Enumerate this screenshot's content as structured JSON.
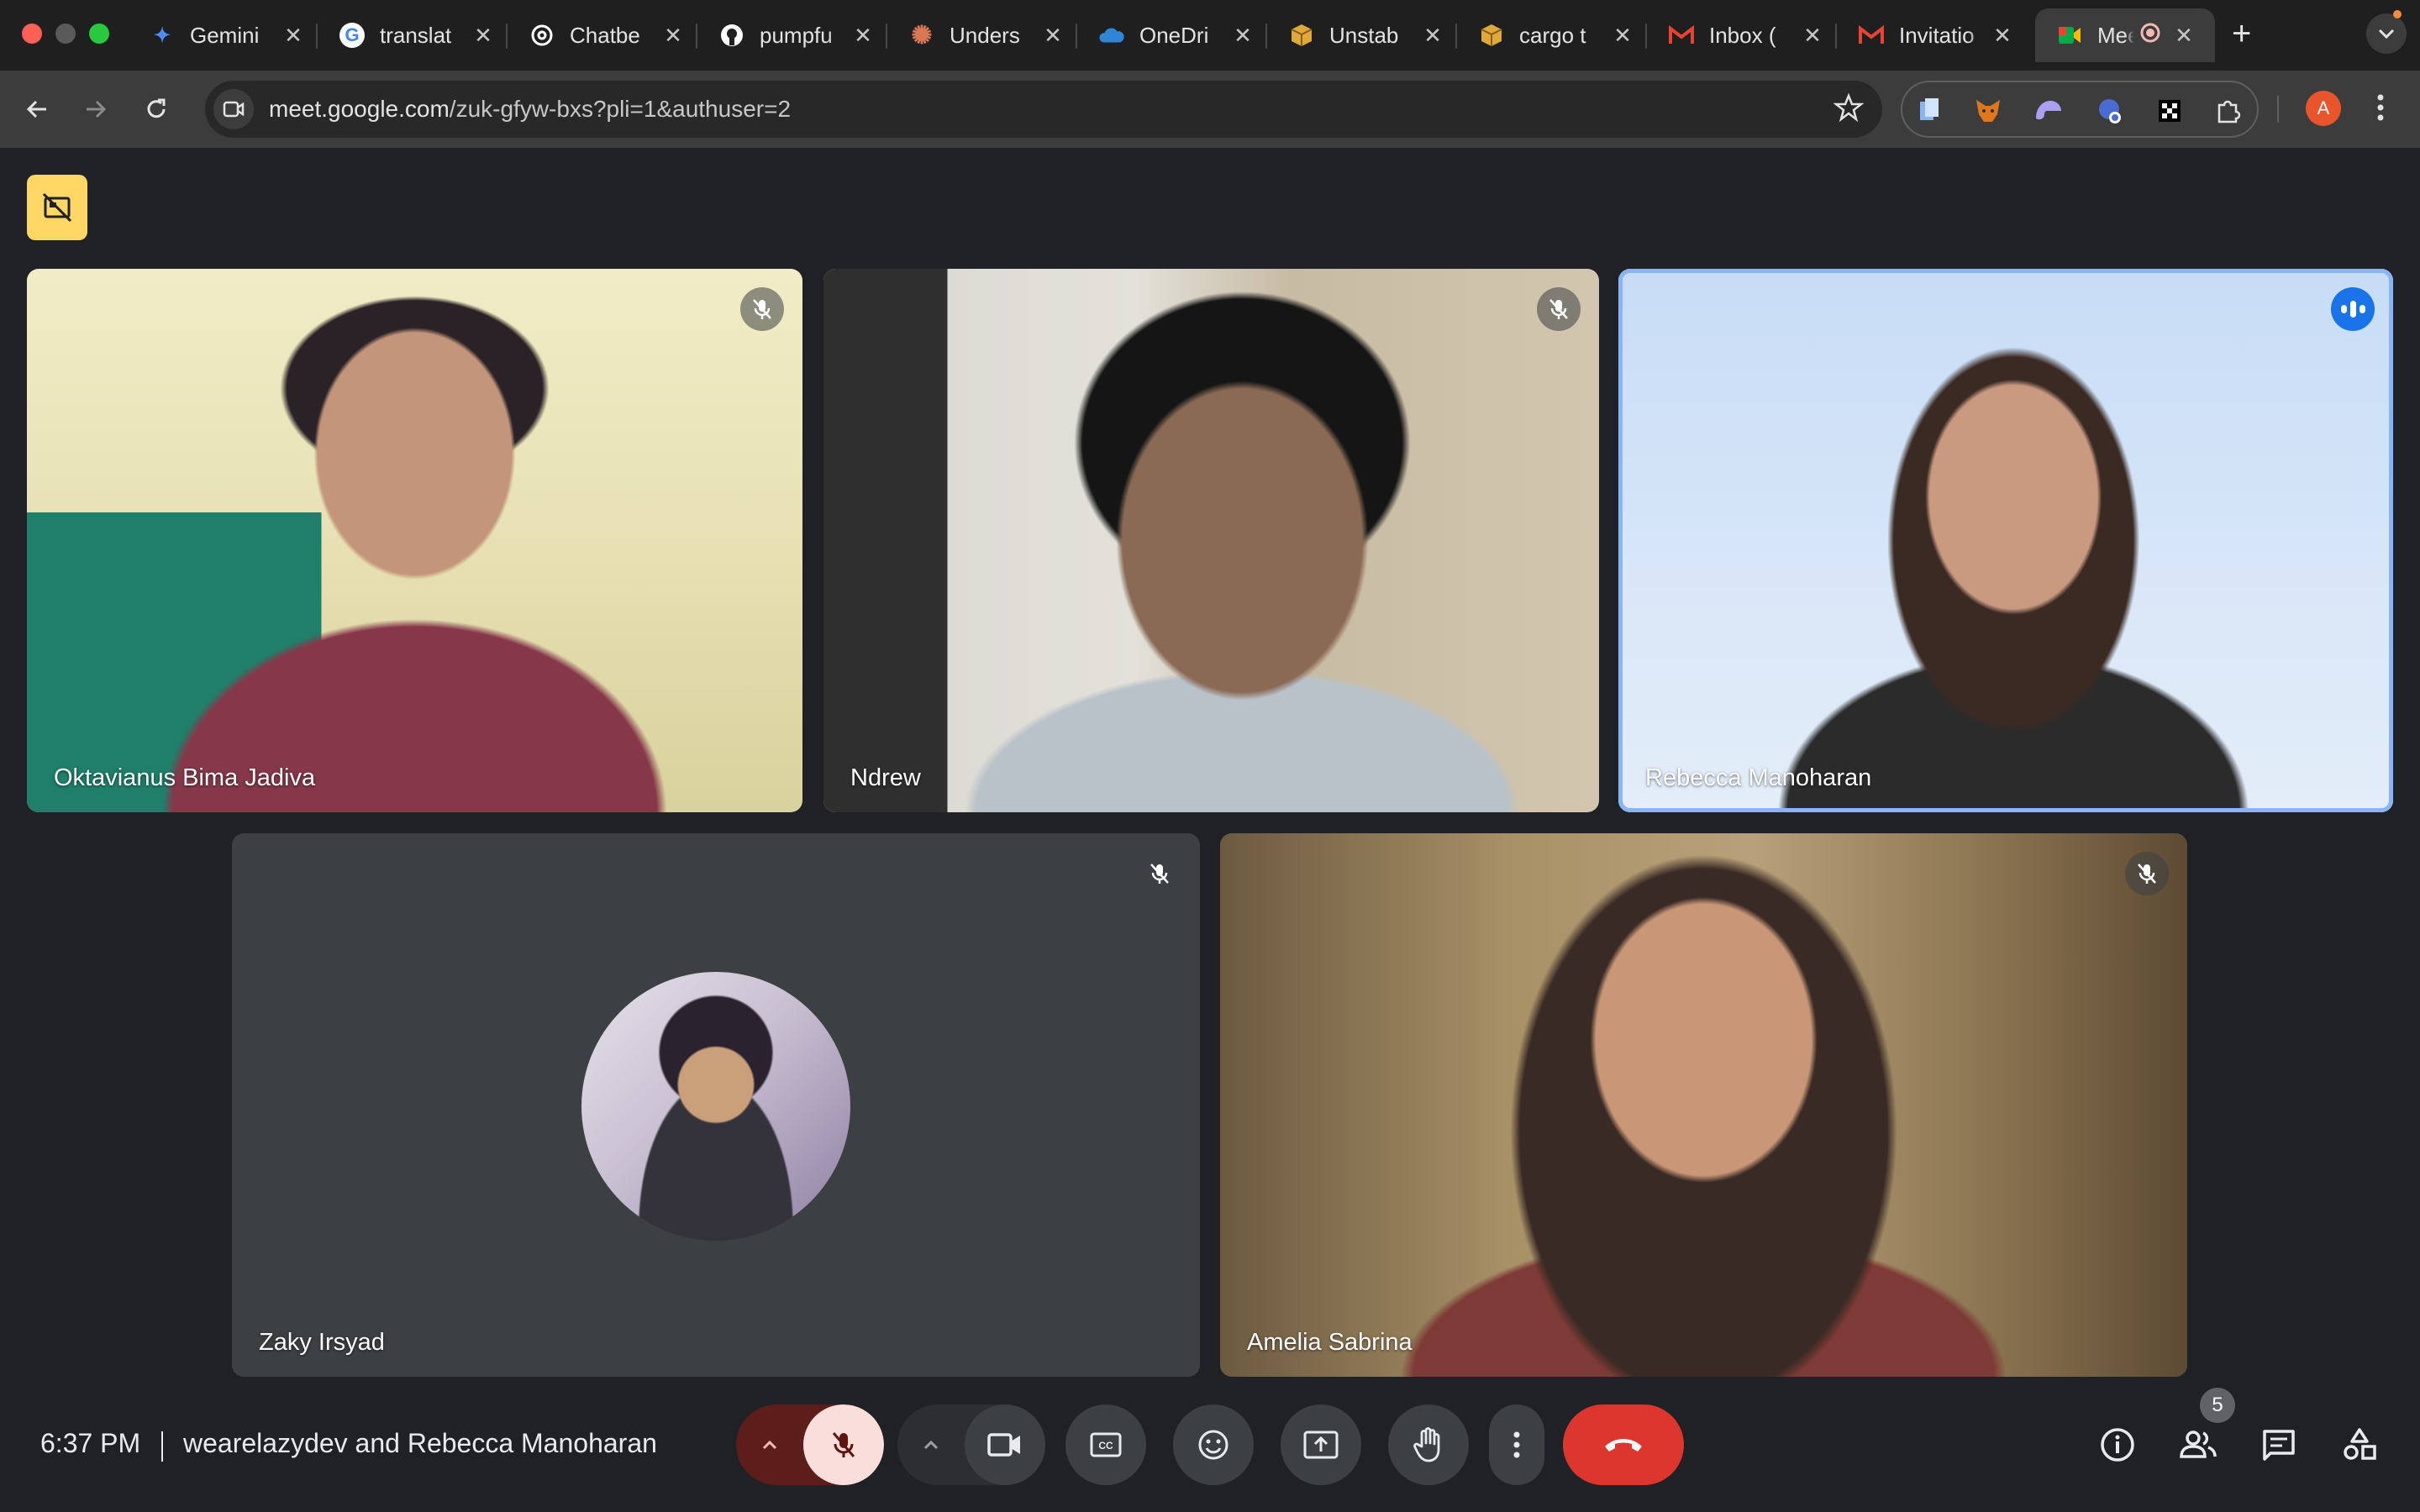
{
  "browser": {
    "tabs": [
      {
        "title": "Gemini",
        "icon": "gemini-icon",
        "color": "#4f8ef7"
      },
      {
        "title": "translat",
        "icon": "google-icon",
        "color": "#ffffff"
      },
      {
        "title": "Chatbe",
        "icon": "openai-icon",
        "color": "#ffffff"
      },
      {
        "title": "pumpfu",
        "icon": "github-icon",
        "color": "#ffffff"
      },
      {
        "title": "Unders",
        "icon": "claude-icon",
        "color": "#d97757"
      },
      {
        "title": "OneDri",
        "icon": "onedrive-icon",
        "color": "#2f86d8"
      },
      {
        "title": "Unstab",
        "icon": "package-icon",
        "color": "#e0a93b"
      },
      {
        "title": "cargo t",
        "icon": "package-icon",
        "color": "#e0a93b"
      },
      {
        "title": "Inbox (",
        "icon": "gmail-icon",
        "color": "#ea4335"
      },
      {
        "title": "Invitatio",
        "icon": "gmail-icon",
        "color": "#ea4335"
      },
      {
        "title": "Mee",
        "icon": "meet-icon",
        "color": "#00ac47"
      }
    ],
    "new_tab_label": "+",
    "url_host": "meet.google.com",
    "url_path": "/zuk-gfyw-bxs?pli=1&authuser=2",
    "profile_initial": "A",
    "profile_color": "#e8542c"
  },
  "meeting": {
    "participants": [
      {
        "name": "Oktavianus Bima Jadiva",
        "muted": true
      },
      {
        "name": "Ndrew",
        "muted": true
      },
      {
        "name": "Rebecca Manoharan",
        "muted": false,
        "speaking": true
      },
      {
        "name": "Zaky Irsyad",
        "muted": true,
        "camera": "off"
      },
      {
        "name": "Amelia Sabrina",
        "muted": true
      }
    ]
  },
  "bottom_bar": {
    "time": "6:37 PM",
    "meeting_title": "wearelazydev and Rebecca Manoharan",
    "people_count": "5"
  },
  "colors": {
    "background": "#202124",
    "tile": "#3c4043",
    "end_call": "#dc362e",
    "speaking_border": "#8ab4f8",
    "hidden_tiles_button": "#fdd663"
  }
}
